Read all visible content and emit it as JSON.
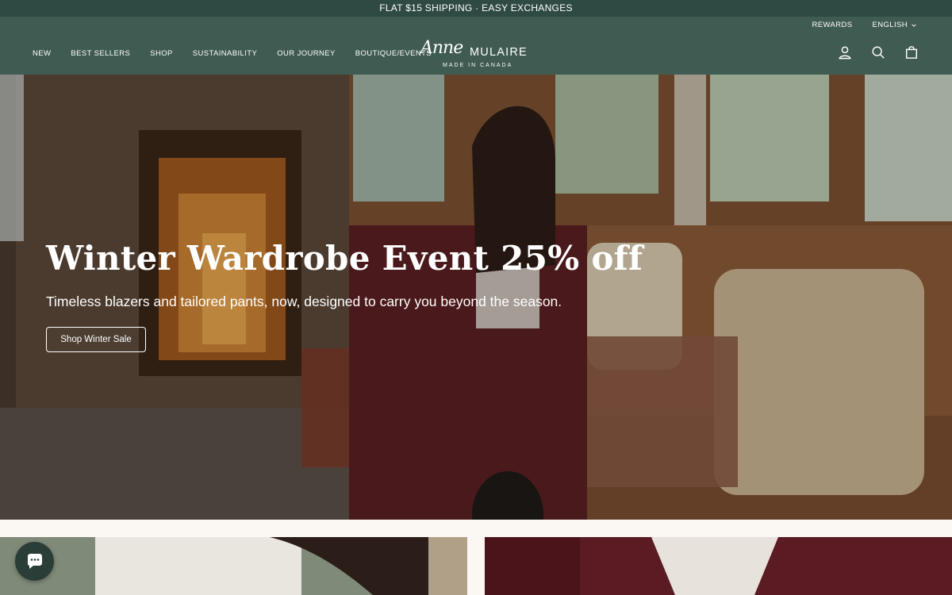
{
  "announcement": "FLAT $15 SHIPPING · EASY EXCHANGES",
  "utility": {
    "rewards": "REWARDS",
    "language": "ENGLISH"
  },
  "nav": [
    "NEW",
    "BEST SELLERS",
    "SHOP",
    "SUSTAINABILITY",
    "OUR JOURNEY",
    "BOUTIQUE/EVENTS"
  ],
  "logo": {
    "script": "Anne",
    "wordmark": "MULAIRE",
    "tagline": "MADE IN CANADA"
  },
  "header_icons": [
    "account-icon",
    "search-icon",
    "cart-icon"
  ],
  "hero": {
    "title": "Winter Wardrobe Event 25% off",
    "subtitle": "Timeless blazers and tailored pants, now, designed to carry you beyond the season.",
    "button": "Shop Winter Sale"
  },
  "colors": {
    "header": "#3f5b52",
    "announcement": "#2f4a42",
    "burgundy": "#5a1b22"
  }
}
